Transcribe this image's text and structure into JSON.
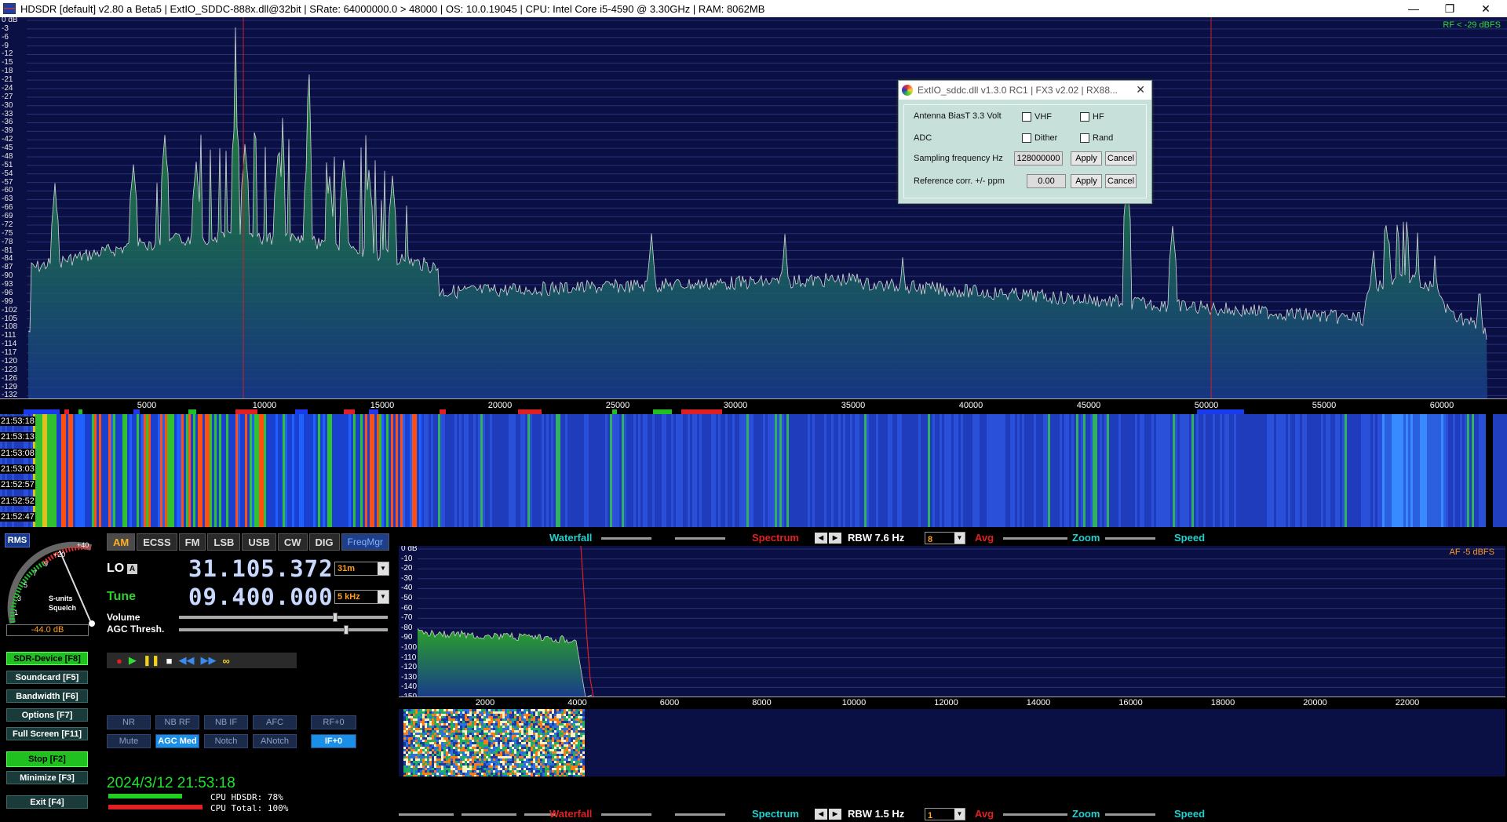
{
  "window": {
    "title": "HDSDR  [default]  v2.80 a Beta5   |  ExtIO_SDDC-888x.dll@32bit   |  SRate: 64000000.0 > 48000   |  OS: 10.0.19045   |  CPU: Intel Core i5-4590 @ 3.30GHz   |  RAM: 8062MB",
    "minimize": "—",
    "restore": "❐",
    "close": "✕"
  },
  "rf_spectrum": {
    "level_label": "RF < -29 dBFS",
    "db_scale": [
      "0 dB",
      "-3",
      "-6",
      "-9",
      "-12",
      "-15",
      "-18",
      "-21",
      "-24",
      "-27",
      "-30",
      "-33",
      "-36",
      "-39",
      "-42",
      "-45",
      "-48",
      "-51",
      "-54",
      "-57",
      "-60",
      "-63",
      "-66",
      "-69",
      "-72",
      "-75",
      "-78",
      "-81",
      "-84",
      "-87",
      "-90",
      "-93",
      "-96",
      "-99",
      "-102",
      "-105",
      "-108",
      "-111",
      "-114",
      "-117",
      "-120",
      "-123",
      "-126",
      "-129",
      "-132"
    ],
    "freq_ticks": [
      "5000",
      "10000",
      "15000",
      "20000",
      "25000",
      "30000",
      "35000",
      "40000",
      "45000",
      "50000",
      "55000",
      "60000"
    ]
  },
  "waterfall": {
    "timestamps": [
      "21:53:18",
      "21:53:13",
      "21:53:08",
      "21:53:03",
      "21:52:57",
      "21:52:52",
      "21:52:47"
    ]
  },
  "controls": {
    "rms_label": "RMS",
    "meter_scale": [
      "1",
      "3",
      "5",
      "7",
      "9",
      "+20",
      "+40"
    ],
    "meter_caption_1": "S-units",
    "meter_caption_2": "Squelch",
    "db_readout": "-44.0 dB",
    "modes": [
      "AM",
      "ECSS",
      "FM",
      "LSB",
      "USB",
      "CW",
      "DIG"
    ],
    "freqmgr": "FreqMgr",
    "lo_label": "LO",
    "lo_badge": "A",
    "lo_freq": "31.105.372",
    "lo_band": "31m",
    "tune_label": "Tune",
    "tune_freq": "09.400.000",
    "tune_step": "5 kHz",
    "volume_label": "Volume",
    "agc_label": "AGC Thresh.",
    "left_buttons": [
      "SDR-Device [F8]",
      "Soundcard  [F5]",
      "Bandwidth  [F6]",
      "Options  [F7]",
      "Full Screen [F11]",
      "Stop    [F2]",
      "Minimize  [F3]",
      "Exit    [F4]"
    ],
    "dsp_row1": [
      "NR",
      "NB RF",
      "NB IF",
      "AFC",
      "RF+0"
    ],
    "dsp_row2": [
      "Mute",
      "AGC Med",
      "Notch",
      "ANotch",
      "IF+0"
    ],
    "datetime": "2024/3/12 21:53:18",
    "cpu_hdsdr": "CPU HDSDR: 78%",
    "cpu_total": "CPU Total: 100%"
  },
  "af_toolbar_top": {
    "waterfall": "Waterfall",
    "spectrum": "Spectrum",
    "rbw": "RBW  7.6 Hz",
    "avg_value": "8",
    "avg": "Avg",
    "zoom": "Zoom",
    "speed": "Speed"
  },
  "af_toolbar_bottom": {
    "waterfall": "Waterfall",
    "spectrum": "Spectrum",
    "rbw": "RBW  1.5 Hz",
    "avg_value": "1",
    "avg": "Avg",
    "zoom": "Zoom",
    "speed": "Speed"
  },
  "af_spectrum": {
    "level_label": "AF  -5 dBFS",
    "db_scale": [
      "0 dB",
      "-10",
      "-20",
      "-30",
      "-40",
      "-50",
      "-60",
      "-70",
      "-80",
      "-90",
      "-100",
      "-110",
      "-120",
      "-130",
      "-140",
      "-150"
    ],
    "freq_ticks": [
      "2000",
      "4000",
      "6000",
      "8000",
      "10000",
      "12000",
      "14000",
      "16000",
      "18000",
      "20000",
      "22000"
    ]
  },
  "dialog": {
    "title": "ExtIO_sddc.dll v1.3.0 RC1 | FX3 v2.02 | RX88...",
    "close": "✕",
    "bias_label": "Antenna BiasT 3.3 Volt",
    "vhf": "VHF",
    "hf": "HF",
    "adc_label": "ADC",
    "dither": "Dither",
    "rand": "Rand",
    "sampling_label": "Sampling frequency  Hz",
    "sampling_value": "128000000",
    "refcorr_label": "Reference corr. +/- ppm",
    "refcorr_value": "0.00",
    "apply": "Apply",
    "cancel": "Cancel"
  },
  "colors": {
    "spectrum_bg": "#0a0f44",
    "trace": "#d8d8d8",
    "accent_green": "#20e030",
    "accent_orange": "#ff9e20",
    "waterfall_blue": "#1f3fbf",
    "marker_red": "#d02020"
  }
}
